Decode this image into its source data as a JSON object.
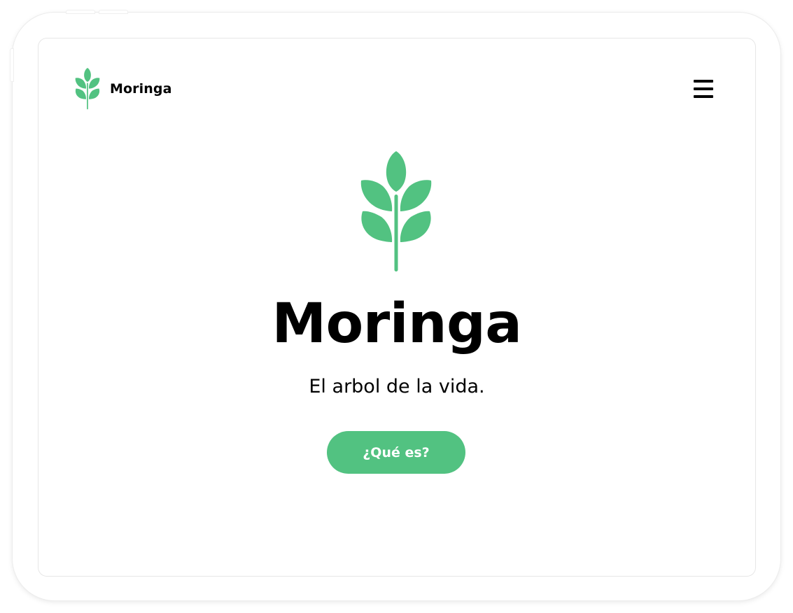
{
  "brand": {
    "name": "Moringa",
    "icon": "moringa-leaf-icon",
    "color": "#52c281"
  },
  "navbar": {
    "menu_icon": "hamburger-menu-icon"
  },
  "hero": {
    "icon": "moringa-leaf-icon",
    "title": "Moringa",
    "subtitle": "El arbol de la vida.",
    "cta_label": "¿Qué es?"
  },
  "colors": {
    "accent": "#52c281",
    "text": "#000000",
    "background": "#ffffff"
  }
}
